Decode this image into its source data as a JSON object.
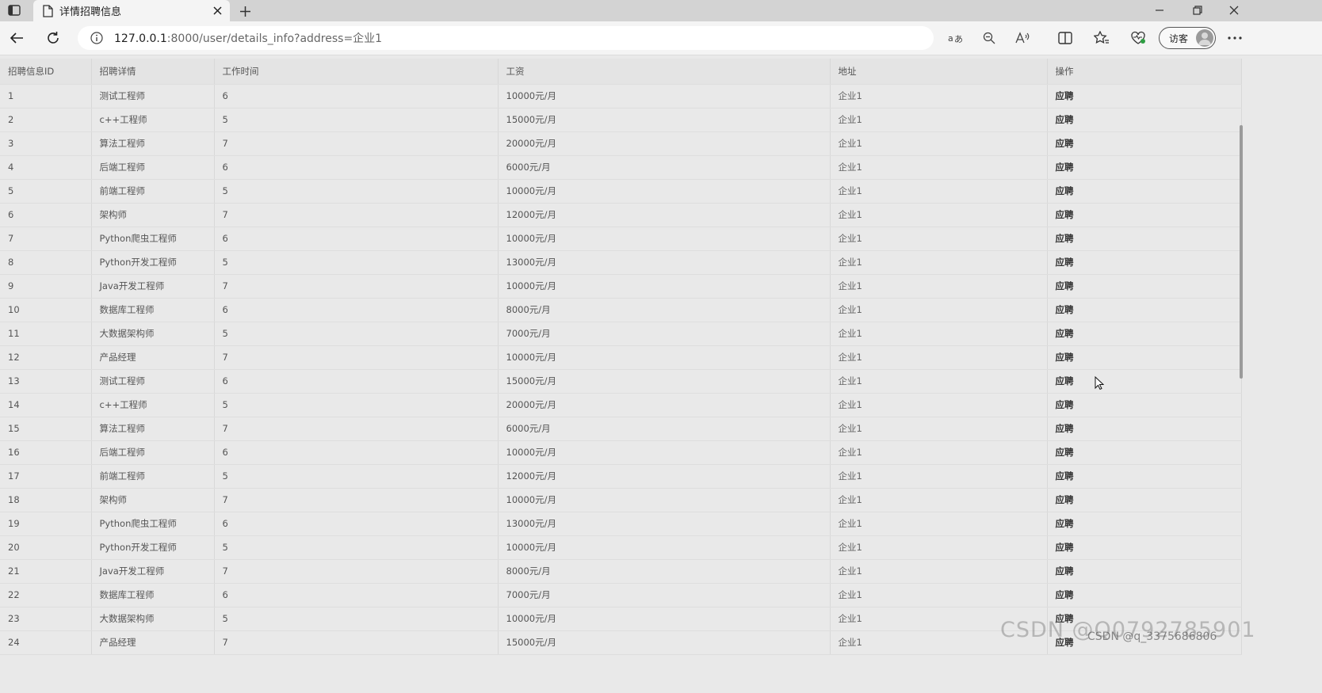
{
  "browser": {
    "tab": {
      "title": "详情招聘信息"
    },
    "address": {
      "host": "127.0.0.1",
      "rest": ":8000/user/details_info?address=企业1"
    },
    "profile": {
      "name": "访客"
    }
  },
  "table": {
    "columns": [
      "招聘信息ID",
      "招聘详情",
      "工作时间",
      "工资",
      "地址",
      "操作"
    ],
    "action_label": "应聘",
    "rows": [
      [
        "1",
        "测试工程师",
        "6",
        "10000元/月",
        "企业1"
      ],
      [
        "2",
        "c++工程师",
        "5",
        "15000元/月",
        "企业1"
      ],
      [
        "3",
        "算法工程师",
        "7",
        "20000元/月",
        "企业1"
      ],
      [
        "4",
        "后端工程师",
        "6",
        "6000元/月",
        "企业1"
      ],
      [
        "5",
        "前端工程师",
        "5",
        "10000元/月",
        "企业1"
      ],
      [
        "6",
        "架构师",
        "7",
        "12000元/月",
        "企业1"
      ],
      [
        "7",
        "Python爬虫工程师",
        "6",
        "10000元/月",
        "企业1"
      ],
      [
        "8",
        "Python开发工程师",
        "5",
        "13000元/月",
        "企业1"
      ],
      [
        "9",
        "Java开发工程师",
        "7",
        "10000元/月",
        "企业1"
      ],
      [
        "10",
        "数据库工程师",
        "6",
        "8000元/月",
        "企业1"
      ],
      [
        "11",
        "大数据架构师",
        "5",
        "7000元/月",
        "企业1"
      ],
      [
        "12",
        "产品经理",
        "7",
        "10000元/月",
        "企业1"
      ],
      [
        "13",
        "测试工程师",
        "6",
        "15000元/月",
        "企业1"
      ],
      [
        "14",
        "c++工程师",
        "5",
        "20000元/月",
        "企业1"
      ],
      [
        "15",
        "算法工程师",
        "7",
        "6000元/月",
        "企业1"
      ],
      [
        "16",
        "后端工程师",
        "6",
        "10000元/月",
        "企业1"
      ],
      [
        "17",
        "前端工程师",
        "5",
        "12000元/月",
        "企业1"
      ],
      [
        "18",
        "架构师",
        "7",
        "10000元/月",
        "企业1"
      ],
      [
        "19",
        "Python爬虫工程师",
        "6",
        "13000元/月",
        "企业1"
      ],
      [
        "20",
        "Python开发工程师",
        "5",
        "10000元/月",
        "企业1"
      ],
      [
        "21",
        "Java开发工程师",
        "7",
        "8000元/月",
        "企业1"
      ],
      [
        "22",
        "数据库工程师",
        "6",
        "7000元/月",
        "企业1"
      ],
      [
        "23",
        "大数据架构师",
        "5",
        "10000元/月",
        "企业1"
      ],
      [
        "24",
        "产品经理",
        "7",
        "15000元/月",
        "企业1"
      ]
    ]
  },
  "watermark": {
    "text": "CSDN @Q0792785901",
    "sub": "CSDN @q_3375686806"
  }
}
